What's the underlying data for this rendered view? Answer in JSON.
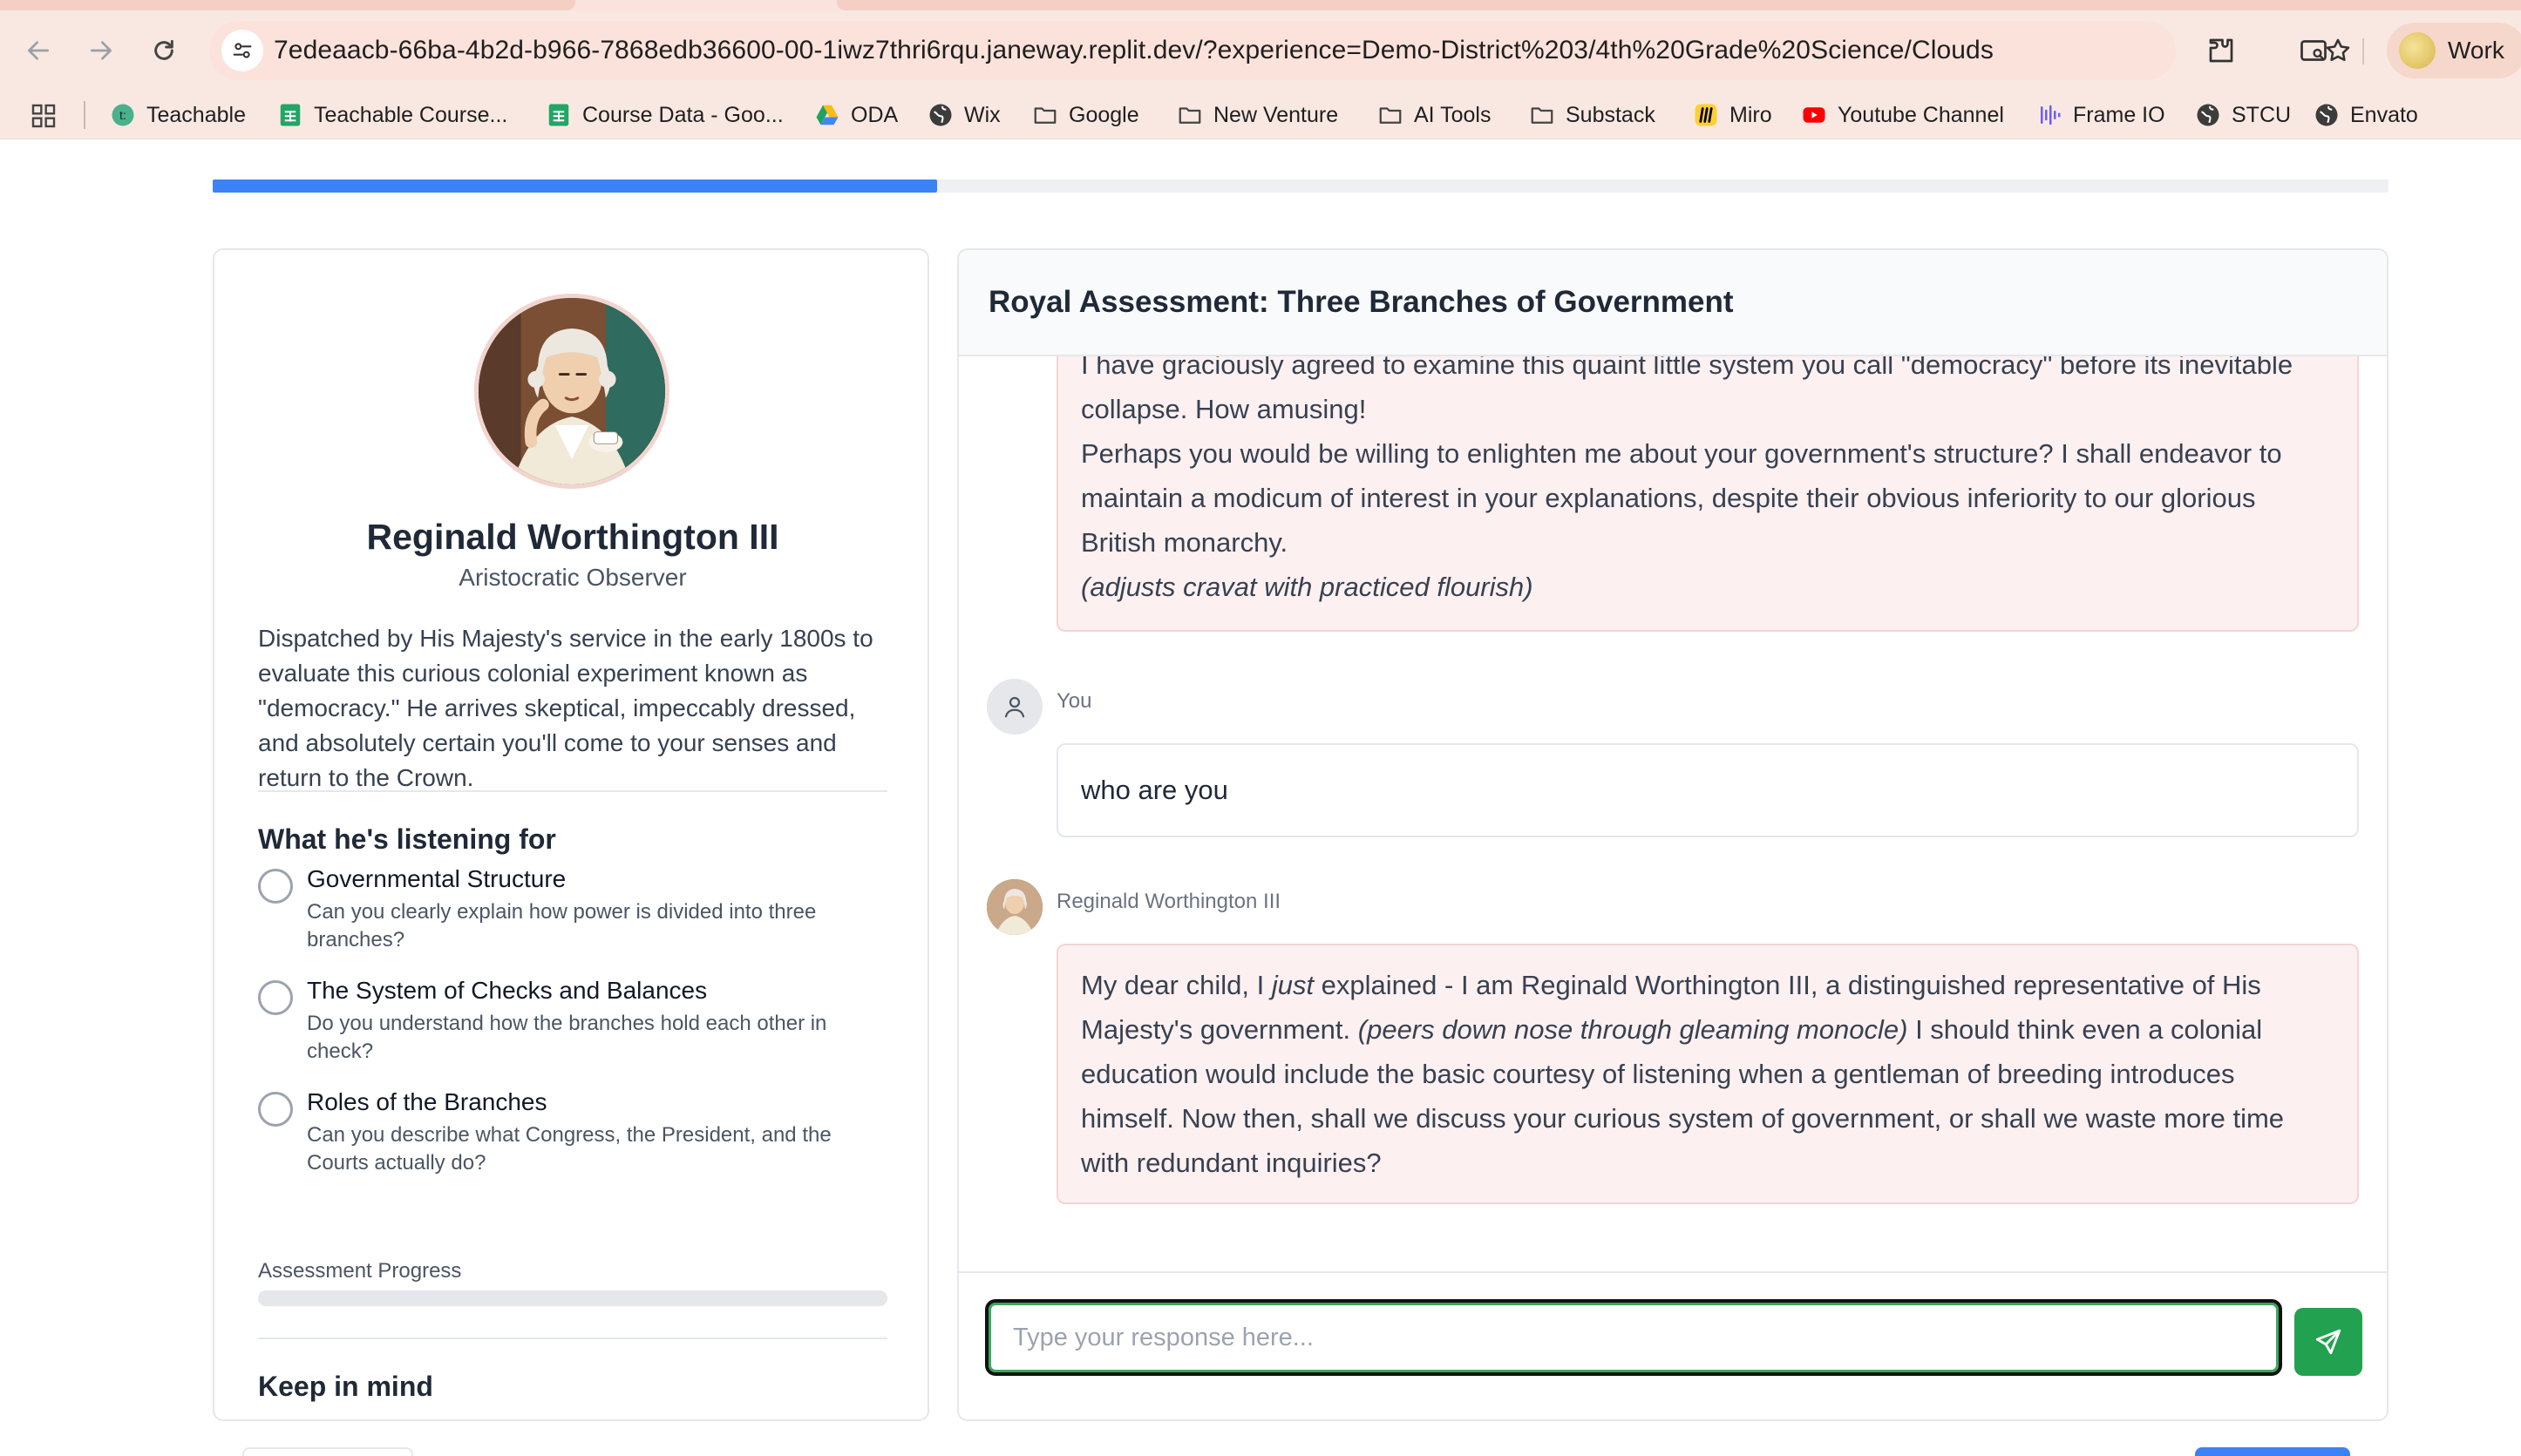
{
  "browser": {
    "url": "7edeaacb-66ba-4b2d-b966-7868edb36600-00-1iwz7thri6rqu.janeway.replit.dev/?experience=Demo-District%203/4th%20Grade%20Science/Clouds",
    "profile_label": "Work",
    "bookmarks": [
      {
        "label": "Teachable",
        "icon": "teachable-icon"
      },
      {
        "label": "Teachable Course...",
        "icon": "sheets-icon"
      },
      {
        "label": "Course Data - Goo...",
        "icon": "sheets-icon"
      },
      {
        "label": "ODA",
        "icon": "drive-icon"
      },
      {
        "label": "Wix",
        "icon": "globe-icon"
      },
      {
        "label": "Google",
        "icon": "folder-icon"
      },
      {
        "label": "New Venture",
        "icon": "folder-icon"
      },
      {
        "label": "AI Tools",
        "icon": "folder-icon"
      },
      {
        "label": "Substack",
        "icon": "folder-icon"
      },
      {
        "label": "Miro",
        "icon": "miro-icon"
      },
      {
        "label": "Youtube Channel",
        "icon": "youtube-icon"
      },
      {
        "label": "Frame IO",
        "icon": "frameio-icon"
      },
      {
        "label": "STCU",
        "icon": "globe-icon"
      },
      {
        "label": "Envato",
        "icon": "globe-icon"
      }
    ]
  },
  "page": {
    "progress_fraction": 0.333
  },
  "character": {
    "name": "Reginald Worthington III",
    "role": "Aristocratic Observer",
    "bio": "Dispatched by His Majesty's service in the early 1800s to evaluate this curious colonial experiment known as \"democracy.\" He arrives skeptical, impeccably dressed, and absolutely certain you'll come to your senses and return to the Crown.",
    "listening_heading": "What he's listening for",
    "criteria": [
      {
        "title": "Governmental Structure",
        "desc": "Can you clearly explain how power is divided into three branches?"
      },
      {
        "title": "The System of Checks and Balances",
        "desc": "Do you understand how the branches hold each other in check?"
      },
      {
        "title": "Roles of the Branches",
        "desc": "Can you describe what Congress, the President, and the Courts actually do?"
      }
    ],
    "assessment_progress_label": "Assessment Progress",
    "assessment_progress_fraction": 0,
    "keep_in_mind_heading": "Keep in mind"
  },
  "chat": {
    "title": "Royal Assessment: Three Branches of Government",
    "first_message": {
      "line1": "I have graciously agreed to examine this quaint little system you call \"democracy\" before its inevitable collapse. How amusing!",
      "line2": "Perhaps you would be willing to enlighten me about your government's structure? I shall endeavor to maintain a modicum of interest in your explanations, despite their obvious inferiority to our glorious British monarchy.",
      "line3": "(adjusts cravat with practiced flourish)"
    },
    "user_name": "You",
    "user_message": "who are you",
    "ai_name": "Reginald Worthington III",
    "reply": {
      "part1": "My dear child, I ",
      "emph": "just",
      "part2": " explained - I am Reginald Worthington III, a distinguished representative of His Majesty's government. ",
      "aside": "(peers down nose through gleaming monocle)",
      "part3": " I should think even a colonial education would include the basic courtesy of listening when a gentleman of breeding introduces himself. Now then, shall we discuss your curious system of government, or shall we waste more time with redundant inquiries?"
    },
    "input_placeholder": "Type your response here..."
  },
  "colors": {
    "accent_blue": "#3b82f6",
    "send_green": "#22a150",
    "ai_bubble": "#fdf0f0"
  }
}
